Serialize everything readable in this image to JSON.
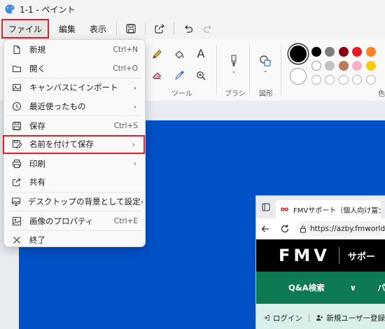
{
  "window": {
    "title": "1-1 - ペイント"
  },
  "menubar": {
    "file": "ファイル",
    "edit": "編集",
    "view": "表示"
  },
  "ribbon": {
    "tools_label": "ツール",
    "brush_label": "ブラシ",
    "shapes_label": "図形",
    "colors_label": "色",
    "text_tool": "A",
    "palette": [
      "#000000",
      "#7f7f7f",
      "#880015",
      "#ed1c24",
      "#ff7f27",
      "#ffffff",
      "#c3c3c3",
      "#b97a57",
      "#ffaec9",
      "#ffc90e"
    ]
  },
  "file_menu": {
    "items": [
      {
        "label": "新規",
        "shortcut": "Ctrl+N",
        "icon": "new-file-icon"
      },
      {
        "label": "開く",
        "shortcut": "Ctrl+O",
        "icon": "folder-icon"
      },
      {
        "label": "キャンバスにインポート",
        "arrow": "›",
        "icon": "import-image-icon"
      },
      {
        "label": "最近使ったもの",
        "arrow": "›",
        "icon": "clock-icon"
      },
      {
        "label": "保存",
        "shortcut": "Ctrl+S",
        "icon": "save-icon"
      },
      {
        "label": "名前を付けて保存",
        "arrow": "›",
        "icon": "save-as-icon"
      },
      {
        "label": "印刷",
        "arrow": "›",
        "icon": "printer-icon"
      },
      {
        "label": "共有",
        "icon": "share-icon"
      },
      {
        "label": "デスクトップの背景として設定",
        "arrow": "›",
        "icon": "desktop-background-icon"
      },
      {
        "label": "画像のプロパティ",
        "shortcut": "Ctrl+E",
        "icon": "properties-icon"
      },
      {
        "label": "終了",
        "icon": "close-icon"
      }
    ]
  },
  "browser": {
    "tab_title": "FMVサポート（個人向け富士通",
    "url": "https://azby.fmworld",
    "logo": "FMV",
    "site_subtitle": "サポー",
    "nav_qa": "Q&A検索",
    "nav_chevron": "∨",
    "nav_more": "パ",
    "login": "ログイン",
    "register": "新規ユーザー登録"
  },
  "colors": {
    "canvas_blue": "#0050c8",
    "highlight_red": "#e0212a",
    "fmv_green": "#0e7a53"
  }
}
